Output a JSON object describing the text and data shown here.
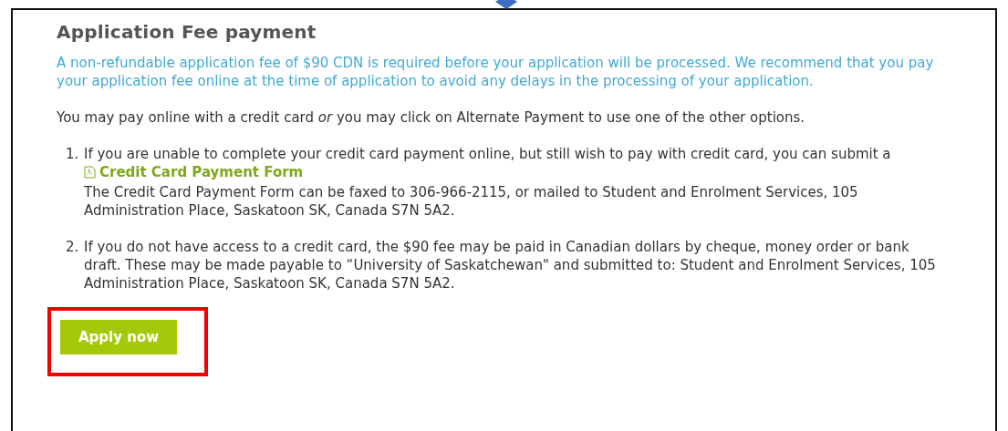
{
  "section": {
    "title": "Application Fee payment",
    "notice": "A non-refundable application fee of $90 CDN is required before your application will be processed. We recommend that you pay your application fee online at the time of application to avoid any delays in the processing of your application.",
    "intro": "You may pay online with a credit card *or* you may click on Alternate Payment to use one of the other options.",
    "options": [
      {
        "number": "1.",
        "text": "If you are unable to complete your credit card payment online, but still wish to pay with credit card, you can submit a",
        "link": "Credit Card Payment Form",
        "after": "The Credit Card Payment Form can be faxed to 306-966-2115, or mailed to Student and Enrolment Services, 105 Administration Place, Saskatoon SK, Canada S7N 5A2."
      },
      {
        "number": "2.",
        "text": "If you do not have access to a credit card, the $90 fee may be paid in Canadian dollars by cheque, money order or bank draft. These may be made payable to “University of Saskatchewan\" and submitted to: Student and Enrolment Services, 105 Administration Place, Saskatoon SK, Canada S7N 5A2."
      }
    ],
    "button": {
      "label": "Apply now",
      "highlighted": true
    }
  }
}
